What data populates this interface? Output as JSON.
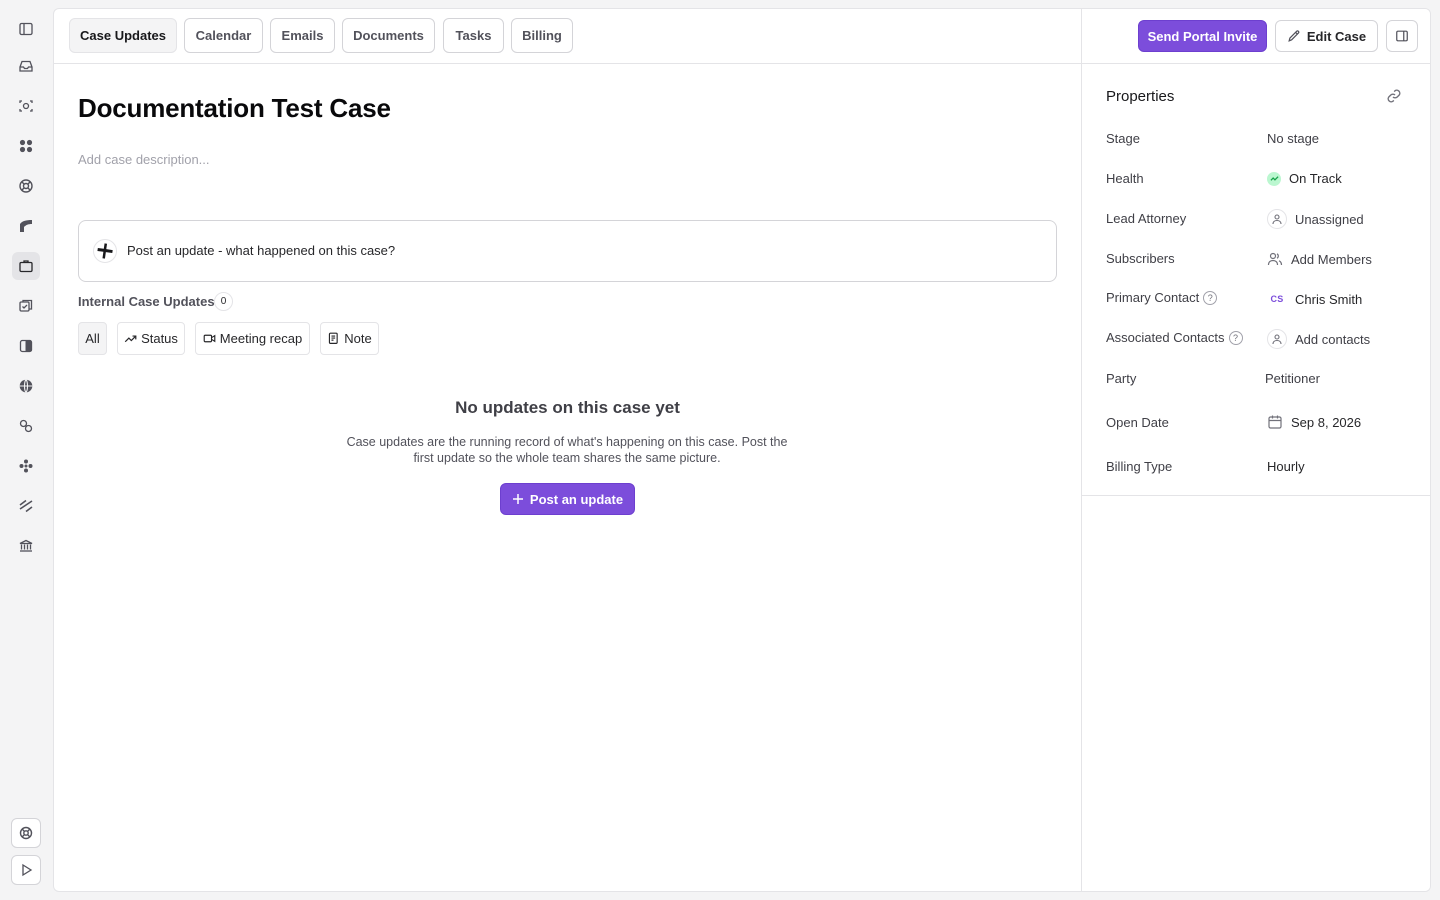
{
  "rail": {
    "icons": [
      {
        "name": "sidebar-toggle-icon"
      },
      {
        "name": "inbox-icon"
      },
      {
        "name": "scan-icon"
      },
      {
        "name": "dashboard-icon"
      },
      {
        "name": "support-icon"
      },
      {
        "name": "chart-icon"
      },
      {
        "name": "briefcase-icon"
      },
      {
        "name": "tasks-icon"
      },
      {
        "name": "book-icon"
      },
      {
        "name": "globe-icon"
      },
      {
        "name": "shapes-icon"
      },
      {
        "name": "modules-icon"
      },
      {
        "name": "layers-icon"
      },
      {
        "name": "bank-icon"
      }
    ],
    "bottom_icons": [
      {
        "name": "help-icon"
      },
      {
        "name": "play-icon"
      }
    ]
  },
  "tabs": [
    "Case Updates",
    "Calendar",
    "Emails",
    "Documents",
    "Tasks",
    "Billing"
  ],
  "active_tab": "Case Updates",
  "header_actions": {
    "send_portal_invite": "Send Portal Invite",
    "edit_case": "Edit Case"
  },
  "case": {
    "title": "Documentation Test Case",
    "description_placeholder": "Add case description..."
  },
  "composer": {
    "placeholder": "Post an update - what happened on this case?"
  },
  "updates": {
    "label": "Internal Case Updates",
    "count": "0",
    "filters": [
      "All",
      "Status",
      "Meeting recap",
      "Note"
    ],
    "active_filter": "All"
  },
  "empty_state": {
    "title": "No updates on this case yet",
    "description": "Case updates are the running record of what's happening on this case. Post the first update so the whole team shares the same picture.",
    "button": "Post an update"
  },
  "properties": {
    "title": "Properties",
    "rows": {
      "stage": {
        "label": "Stage",
        "value": "No stage"
      },
      "health": {
        "label": "Health",
        "value": "On Track"
      },
      "lead_attorney": {
        "label": "Lead Attorney",
        "value": "Unassigned"
      },
      "subscribers": {
        "label": "Subscribers",
        "value": "Add Members"
      },
      "primary_contact": {
        "label": "Primary Contact",
        "value": "Chris Smith",
        "initials": "CS"
      },
      "associated_contacts": {
        "label": "Associated Contacts",
        "value": "Add contacts"
      },
      "party": {
        "label": "Party",
        "value": "Petitioner"
      },
      "open_date": {
        "label": "Open Date",
        "value": "Sep 8, 2026"
      },
      "billing_type": {
        "label": "Billing Type",
        "value": "Hourly"
      }
    }
  },
  "colors": {
    "accent": "#7c4ddb",
    "health_green": "#22c55e"
  }
}
